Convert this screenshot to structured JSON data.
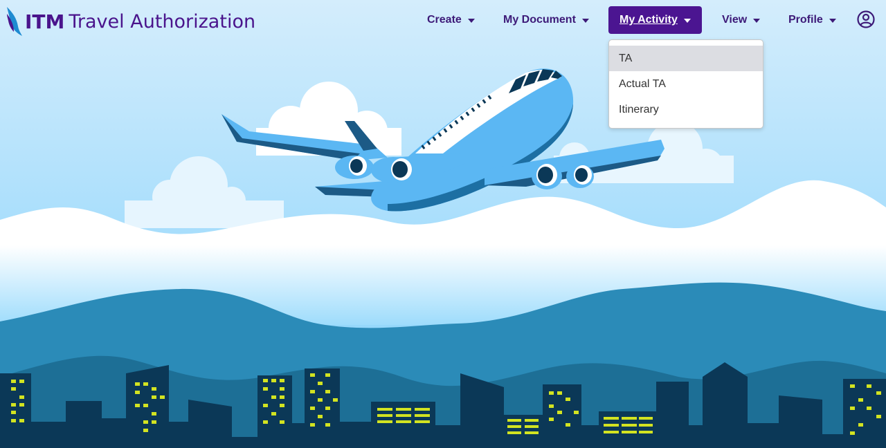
{
  "brand": {
    "short": "ITM",
    "title": "Travel Authorization"
  },
  "nav": {
    "create": "Create",
    "my_document": "My Document",
    "my_activity": "My Activity",
    "view": "View",
    "profile": "Profile"
  },
  "dropdown": {
    "items": [
      "TA",
      "Actual TA",
      "Itinerary"
    ]
  },
  "icons": {
    "user": "user-circle-icon",
    "caret": "caret-down-icon"
  },
  "colors": {
    "brand": "#4a148c",
    "nav_active_bg": "#4b1591",
    "sky": "#cfe9fb"
  }
}
